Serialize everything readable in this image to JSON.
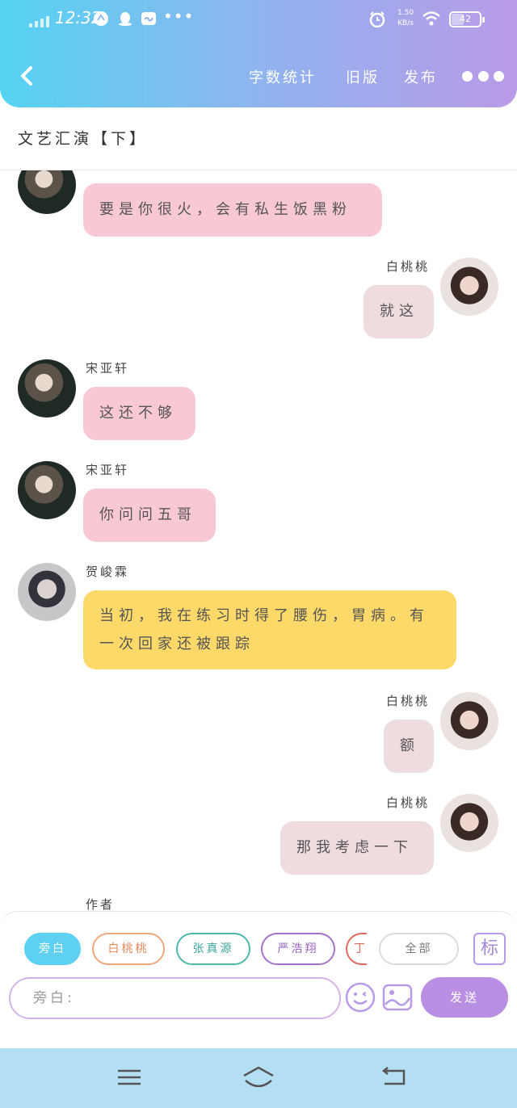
{
  "status_bar": {
    "time": "12:32",
    "net_speed_value": "1.50",
    "net_speed_unit": "KB/s",
    "battery": "42",
    "battery_level": 0.42
  },
  "header": {
    "nav_stats": "字数统计",
    "nav_old": "旧版",
    "nav_publish": "发布"
  },
  "doc_title": "文艺汇演【下】",
  "messages": [
    {
      "name": "",
      "text": "要是你很火，会有私生饭黑粉"
    },
    {
      "name": "白桃桃",
      "text": "就这"
    },
    {
      "name": "宋亚轩",
      "text": "这还不够"
    },
    {
      "name": "宋亚轩",
      "text": "你问问五哥"
    },
    {
      "name": "贺峻霖",
      "text": "当初，我在练习时得了腰伤，胃病。有一次回家还被跟踪"
    },
    {
      "name": "白桃桃",
      "text": "额"
    },
    {
      "name": "白桃桃",
      "text": "那我考虑一下"
    },
    {
      "name": "作者",
      "text": ""
    }
  ],
  "composer": {
    "chips": [
      "旁白",
      "白桃桃",
      "张真源",
      "严浩翔",
      "丁",
      "全部"
    ],
    "mark_label": "标",
    "input_value": "旁白:",
    "send_label": "发送"
  },
  "colors": {
    "header_start": "#55d3f2",
    "header_end": "#b99ae8",
    "bubble_pink": "#f8c8d4",
    "bubble_beige": "#efdcdf",
    "bubble_yellow": "#fcd969",
    "send_button": "#b98fe3",
    "nav_bar": "#b4dff2"
  }
}
